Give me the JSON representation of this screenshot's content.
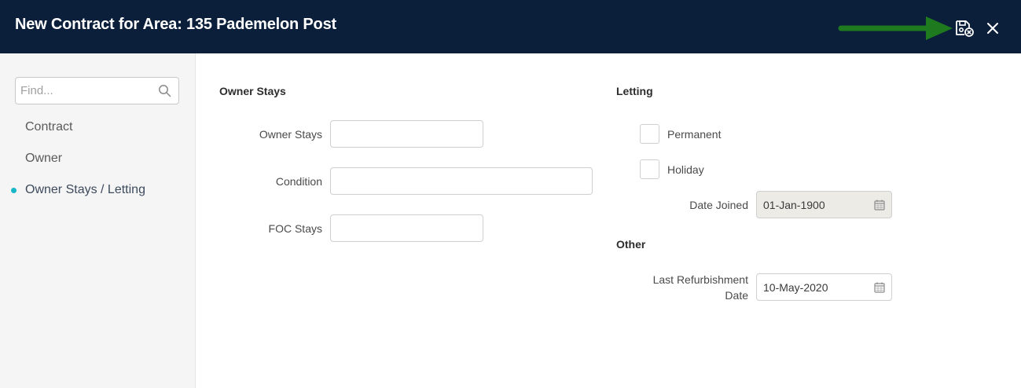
{
  "header": {
    "title": "New Contract for Area: 135 Pademelon Post",
    "save_icon": "save-cancel-icon",
    "close_icon": "close-icon",
    "arrow_color": "#1f7a1f"
  },
  "sidebar": {
    "find_placeholder": "Find...",
    "items": [
      {
        "label": "Contract"
      },
      {
        "label": "Owner"
      },
      {
        "label": "Owner Stays / Letting",
        "active": true
      }
    ],
    "active_color": "#17b7c8"
  },
  "owner_stays": {
    "section_title": "Owner Stays",
    "fields": [
      {
        "label": "Owner Stays",
        "value": ""
      },
      {
        "label": "Condition",
        "value": ""
      },
      {
        "label": "FOC Stays",
        "value": ""
      }
    ]
  },
  "letting": {
    "section_title": "Letting",
    "permanent_label": "Permanent",
    "holiday_label": "Holiday",
    "date_joined_label": "Date Joined",
    "date_joined_value": "01-Jan-1900"
  },
  "other": {
    "section_title": "Other",
    "refurb_label_line1": "Last Refurbishment",
    "refurb_label_line2": "Date",
    "refurb_value": "10-May-2020"
  }
}
